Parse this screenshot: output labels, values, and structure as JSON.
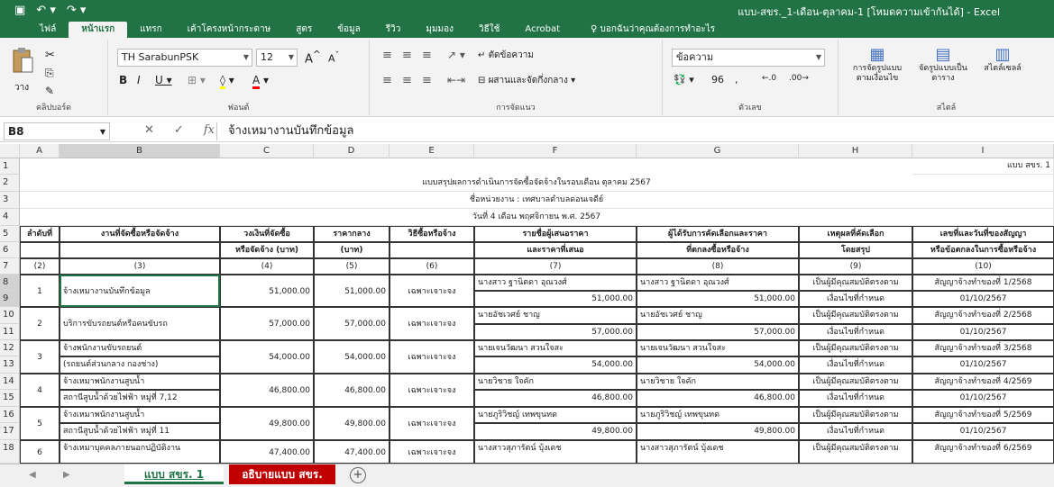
{
  "title_bar": {
    "title": "แบบ-สขร._1-เดือน-ตุลาคม-1 [โหมดความเข้ากันได้] - Excel",
    "save_icon": "save-icon",
    "undo_icon": "undo-icon",
    "redo_icon": "redo-icon"
  },
  "tabs": [
    {
      "label": "ไฟล์"
    },
    {
      "label": "หน้าแรก"
    },
    {
      "label": "แทรก"
    },
    {
      "label": "เค้าโครงหน้ากระดาษ"
    },
    {
      "label": "สูตร"
    },
    {
      "label": "ข้อมูล"
    },
    {
      "label": "รีวิว"
    },
    {
      "label": "มุมมอง"
    },
    {
      "label": "วิธีใช้"
    },
    {
      "label": "Acrobat"
    }
  ],
  "tell_me": "บอกฉันว่าคุณต้องการทำอะไร",
  "ribbon": {
    "paste_label": "วาง",
    "clipboard_label": "คลิปบอร์ด",
    "font_name": "TH SarabunPSK",
    "font_size": "12",
    "font_group_label": "ฟอนต์",
    "wrap_text": "ตัดข้อความ",
    "merge_center": "ผสานและจัดกึ่งกลาง",
    "alignment_label": "การจัดแนว",
    "number_format": "ข้อความ",
    "percent": "96",
    "number_label": "ตัวเลข",
    "conditional_format": "การจัดรูปแบบตามเงื่อนไข",
    "format_table": "จัดรูปแบบเป็นตาราง",
    "cell_styles": "สไตล์เซลล์",
    "styles_label": "สไตล์"
  },
  "formula_bar": {
    "name_box": "B8",
    "content": "จ้างเหมางานบันทึกข้อมูล"
  },
  "columns": [
    "A",
    "B",
    "C",
    "D",
    "E",
    "F",
    "G",
    "H",
    "I"
  ],
  "rows": [
    "1",
    "2",
    "3",
    "4",
    "5",
    "6",
    "7",
    "8",
    "9",
    "10",
    "11",
    "12",
    "13",
    "14",
    "15",
    "16",
    "17",
    "18"
  ],
  "sheet": {
    "corner_label": "แบบ สขร. 1",
    "title": "แบบสรุปผลการดำเนินการจัดซื้อจัดจ้างในรอบเดือน ตุลาคม 2567",
    "agency": "ชื่อหน่วยงาน : เทศบาลตำบลดอนเจดีย์",
    "date": "วันที่ 4 เดือน พฤศจิกายน พ.ศ. 2567",
    "headers_row5": [
      "ลำดับที่",
      "งานที่จัดซื้อหรือจัดจ้าง",
      "วงเงินที่จัดซื้อ",
      "ราคากลาง",
      "วิธีซื้อหรือจ้าง",
      "รายชื่อผู้เสนอราคา",
      "ผู้ได้รับการคัดเลือกและราคา",
      "เหตุผลที่คัดเลือก",
      "เลขที่และวันที่ของสัญญา"
    ],
    "headers_row6": [
      "",
      "",
      "หรือจัดจ้าง (บาท)",
      "(บาท)",
      "",
      "และราคาที่เสนอ",
      "ที่ตกลงซื้อหรือจ้าง",
      "โดยสรุป",
      "หรือข้อตกลงในการซื้อหรือจ้าง"
    ],
    "headers_row7": [
      "(2)",
      "(3)",
      "(4)",
      "(5)",
      "(6)",
      "(7)",
      "(8)",
      "(9)",
      "(10)"
    ],
    "records": [
      {
        "no": "1",
        "item1": "จ้างเหมางานบันทึกข้อมูล",
        "item2": "",
        "budget": "51,000.00",
        "mid": "51,000.00",
        "method": "เฉพาะเจาะจง",
        "bidder": "นางสาว ฐานิตดา อุณวงศ์",
        "bid_price": "51,000.00",
        "winner": "นางสาว ฐานิตดา อุณวงศ์",
        "win_price": "51,000.00",
        "reason1": "เป็นผู้มีคุณสมบัติตรงตาม",
        "reason2": "เงื่อนไขที่กำหนด",
        "contract1": "สัญญาจ้างทำของที่ 1/2568",
        "contract2": "01/10/2567"
      },
      {
        "no": "2",
        "item1": "บริการขับรถยนต์หรือคนขับรถ",
        "item2": "",
        "budget": "57,000.00",
        "mid": "57,000.00",
        "method": "เฉพาะเจาะจง",
        "bidder": "นายอัชเวศย์ ชาญ",
        "bid_price": "57,000.00",
        "winner": "นายอัชเวศย์ ชาญ",
        "win_price": "57,000.00",
        "reason1": "เป็นผู้มีคุณสมบัติตรงตาม",
        "reason2": "เงื่อนไขที่กำหนด",
        "contract1": "สัญญาจ้างทำของที่ 2/2568",
        "contract2": "01/10/2567"
      },
      {
        "no": "3",
        "item1": "จ้างพนักงานขับรถยนต์",
        "item2": "(รถยนต์ส่วนกลาง กองช่าง)",
        "budget": "54,000.00",
        "mid": "54,000.00",
        "method": "เฉพาะเจาะจง",
        "bidder": "นายเจนวัฒนา สวนใจสะ",
        "bid_price": "54,000.00",
        "winner": "นายเจนวัฒนา สวนใจสะ",
        "win_price": "54,000.00",
        "reason1": "เป็นผู้มีคุณสมบัติตรงตาม",
        "reason2": "เงื่อนไขที่กำหนด",
        "contract1": "สัญญาจ้างทำของที่ 3/2568",
        "contract2": "01/10/2567"
      },
      {
        "no": "4",
        "item1": "จ้างเหมาพนักงานสูบน้ำ",
        "item2": "สถานีสูบน้ำด้วยไฟฟ้า หมู่ที่ 7,12",
        "budget": "46,800.00",
        "mid": "46,800.00",
        "method": "เฉพาะเจาะจง",
        "bidder": "นายวิชาย ใจคัก",
        "bid_price": "46,800.00",
        "winner": "นายวิชาย ใจคัก",
        "win_price": "46,800.00",
        "reason1": "เป็นผู้มีคุณสมบัติตรงตาม",
        "reason2": "เงื่อนไขที่กำหนด",
        "contract1": "สัญญาจ้างทำของที่ 4/2569",
        "contract2": "01/10/2567"
      },
      {
        "no": "5",
        "item1": "จ้างเหมาพนักงานสูบน้ำ",
        "item2": "สถานีสูบน้ำด้วยไฟฟ้า หมู่ที่ 11",
        "budget": "49,800.00",
        "mid": "49,800.00",
        "method": "เฉพาะเจาะจง",
        "bidder": "นายภูริวิชญ์ เทพขุนทด",
        "bid_price": "49,800.00",
        "winner": "นายภูริวิชญ์ เทพขุนทด",
        "win_price": "49,800.00",
        "reason1": "เป็นผู้มีคุณสมบัติตรงตาม",
        "reason2": "เงื่อนไขที่กำหนด",
        "contract1": "สัญญาจ้างทำของที่ 5/2569",
        "contract2": "01/10/2567"
      },
      {
        "no": "6",
        "item1": "จ้างเหมาบุคคลภายนอกปฏิบัติงาน",
        "item2": "",
        "budget": "47,400.00",
        "mid": "47,400.00",
        "method": "เฉพาะเจาะจง",
        "bidder": "นางสาวสุภารัตน์ บุ้งเดช",
        "bid_price": "",
        "winner": "นางสาวสุภารัตน์ บุ้งเดช",
        "win_price": "",
        "reason1": "เป็นผู้มีคุณสมบัติตรงตาม",
        "reason2": "",
        "contract1": "สัญญาจ้างทำของที่ 6/2569",
        "contract2": ""
      }
    ]
  },
  "sheet_tabs": [
    {
      "label": "แบบ สขร. 1"
    },
    {
      "label": "อธิบายแบบ สขร. 1"
    }
  ],
  "add_sheet_icon": "plus-circle-icon"
}
